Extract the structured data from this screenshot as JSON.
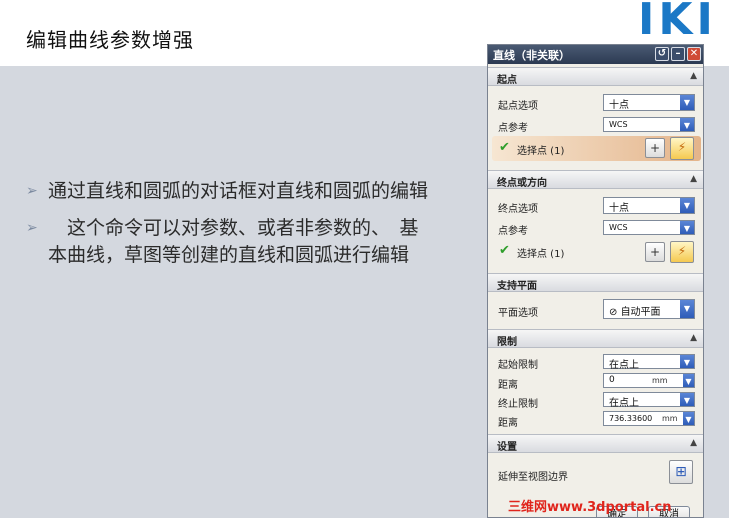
{
  "slide": {
    "title": "编辑曲线参数增强",
    "logo": "IKI",
    "bullets": [
      {
        "marker": "➢",
        "text": "通过直线和圆弧的对话框对直线和圆弧的编辑"
      },
      {
        "marker": "➢",
        "text": "　这个命令可以对参数、或者非参数的、　基本曲线，草图等创建的直线和圆弧进行编辑"
      }
    ]
  },
  "dialog": {
    "title": "直线（非关联）",
    "sections": {
      "start": {
        "label": "起点",
        "option_label": "起点选项",
        "option_value": "十点",
        "ref_label": "点参考",
        "ref_value": "WCS",
        "select_text": "选择点 (1)"
      },
      "end": {
        "label": "终点或方向",
        "option_label": "终点选项",
        "option_value": "十点",
        "ref_label": "点参考",
        "ref_value": "WCS",
        "select_text": "选择点 (1)"
      },
      "support": {
        "label": "支持平面",
        "option_label": "平面选项",
        "option_value": "自动平面"
      },
      "limits": {
        "label": "限制",
        "start_limit_label": "起始限制",
        "start_limit_value": "在点上",
        "distance1_label": "距离",
        "distance1_value": "0",
        "distance1_unit": "mm",
        "end_limit_label": "终止限制",
        "end_limit_value": "在点上",
        "distance2_label": "距离",
        "distance2_value": "736.33600",
        "distance2_unit": "mm"
      },
      "settings": {
        "label": "设置",
        "extend_label": "延伸至视图边界"
      }
    },
    "buttons": {
      "ok": "确定",
      "cancel": "取消"
    }
  },
  "watermark": "三维网www.3dportal.cn"
}
